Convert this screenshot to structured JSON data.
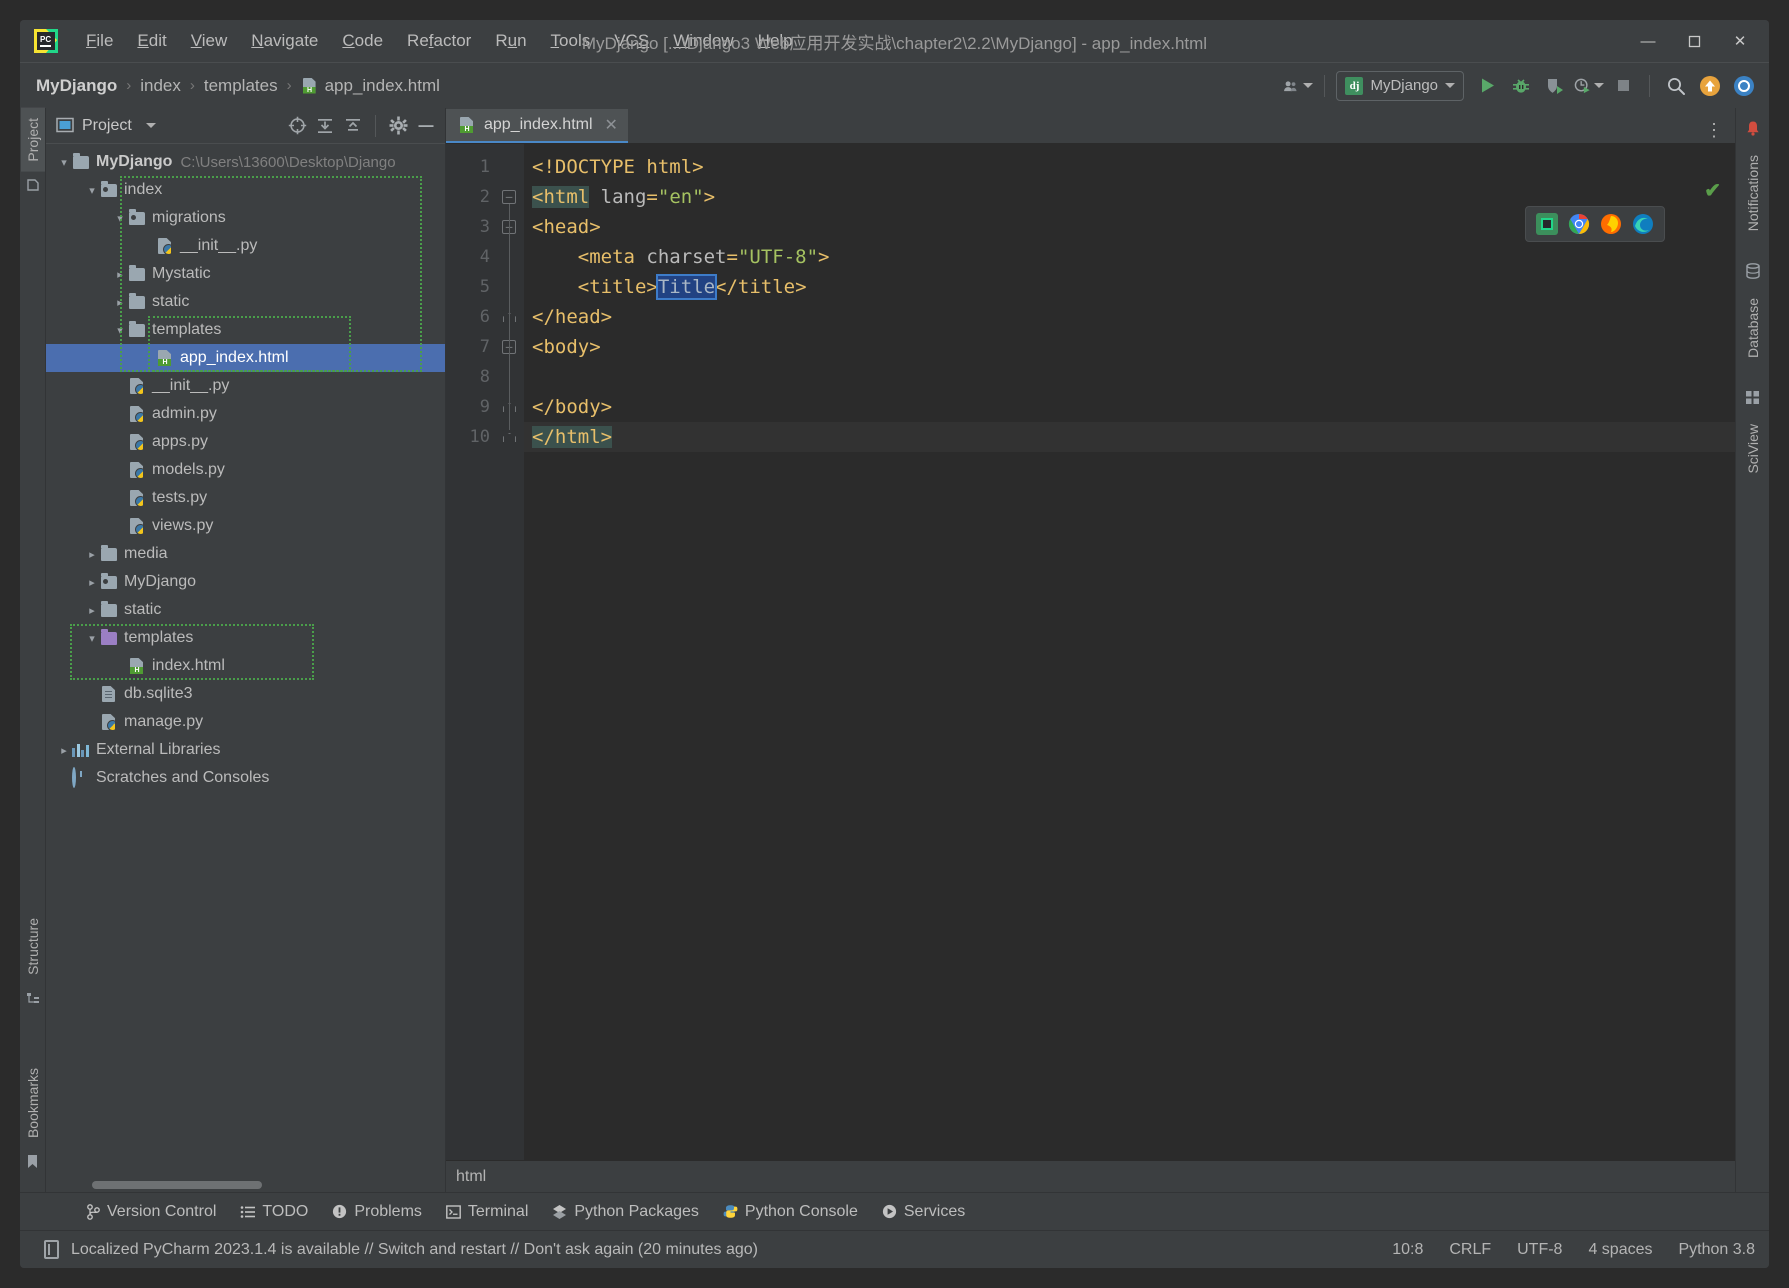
{
  "window": {
    "title": "MyDjango [...\\Django3 Web应用开发实战\\chapter2\\2.2\\MyDjango] - app_index.html",
    "logo_icon": "pycharm-logo-icon",
    "minimize": "—",
    "maximize": "☐",
    "close": "✕"
  },
  "menu": [
    {
      "label": "File"
    },
    {
      "label": "Edit"
    },
    {
      "label": "View"
    },
    {
      "label": "Navigate"
    },
    {
      "label": "Code"
    },
    {
      "label": "Refactor"
    },
    {
      "label": "Run"
    },
    {
      "label": "Tools"
    },
    {
      "label": "VCS"
    },
    {
      "label": "Window"
    },
    {
      "label": "Help"
    }
  ],
  "breadcrumb": {
    "items": [
      "MyDjango",
      "index",
      "templates",
      "app_index.html"
    ],
    "separator": "›",
    "file_icon": "html-file-icon"
  },
  "toolbar": {
    "profile_icon": "user-group-icon",
    "run_config": {
      "badge": "dj",
      "label": "MyDjango",
      "dropdown_icon": "chevron-down-icon"
    },
    "run_icon": "run-play-icon",
    "debug_icon": "debug-bug-icon",
    "coverage_icon": "run-coverage-icon",
    "profile_run_icon": "profiler-clock-icon",
    "stop_icon": "stop-square-icon",
    "search_icon": "search-magnifier-icon",
    "update_icon": "update-arrow-icon",
    "ide_icon": "ide-settings-icon"
  },
  "left_rail": {
    "tabs": [
      "Project",
      "Structure",
      "Bookmarks"
    ],
    "active": "Project",
    "commit_icon": "commit-icon",
    "structure_icon": "structure-icon",
    "bookmark_icon": "bookmark-icon"
  },
  "right_rail": {
    "tabs": [
      "Notifications",
      "Database",
      "SciView"
    ],
    "notification_icon": "bell-icon",
    "database_icon": "database-icon",
    "sciview_icon": "sciview-grid-icon"
  },
  "project_panel": {
    "icon": "project-window-icon",
    "title": "Project",
    "dropdown_icon": "chevron-down-icon",
    "actions": [
      {
        "name": "select-opened-file-icon",
        "glyph": "⊕"
      },
      {
        "name": "expand-all-icon",
        "glyph": "⤓"
      },
      {
        "name": "collapse-all-icon",
        "glyph": "⤒"
      },
      {
        "name": "settings-gear-icon",
        "glyph": "⚙"
      },
      {
        "name": "hide-panel-icon",
        "glyph": "—"
      }
    ],
    "tree": [
      {
        "label": "MyDjango",
        "path": "C:\\Users\\13600\\Desktop\\Django",
        "depth": 0,
        "twisty": "v",
        "icon": "folder",
        "bold": true
      },
      {
        "label": "index",
        "depth": 1,
        "twisty": "v",
        "icon": "folder-module",
        "marked": true
      },
      {
        "label": "migrations",
        "depth": 2,
        "twisty": "v",
        "icon": "folder-module",
        "marked": true
      },
      {
        "label": "__init__.py",
        "depth": 3,
        "twisty": "",
        "icon": "python-file",
        "marked": true
      },
      {
        "label": "Mystatic",
        "depth": 2,
        "twisty": ">",
        "icon": "folder",
        "marked": true
      },
      {
        "label": "static",
        "depth": 2,
        "twisty": ">",
        "icon": "folder",
        "marked": true
      },
      {
        "label": "templates",
        "depth": 2,
        "twisty": "v",
        "icon": "folder",
        "marked": true
      },
      {
        "label": "app_index.html",
        "depth": 3,
        "twisty": "",
        "icon": "html-file",
        "selected": true,
        "marked": true
      },
      {
        "label": "__init__.py",
        "depth": 2,
        "twisty": "",
        "icon": "python-file"
      },
      {
        "label": "admin.py",
        "depth": 2,
        "twisty": "",
        "icon": "python-file"
      },
      {
        "label": "apps.py",
        "depth": 2,
        "twisty": "",
        "icon": "python-file"
      },
      {
        "label": "models.py",
        "depth": 2,
        "twisty": "",
        "icon": "python-file"
      },
      {
        "label": "tests.py",
        "depth": 2,
        "twisty": "",
        "icon": "python-file"
      },
      {
        "label": "views.py",
        "depth": 2,
        "twisty": "",
        "icon": "python-file"
      },
      {
        "label": "media",
        "depth": 1,
        "twisty": ">",
        "icon": "folder"
      },
      {
        "label": "MyDjango",
        "depth": 1,
        "twisty": ">",
        "icon": "folder-module"
      },
      {
        "label": "static",
        "depth": 1,
        "twisty": ">",
        "icon": "folder"
      },
      {
        "label": "templates",
        "depth": 1,
        "twisty": "v",
        "icon": "folder-purple",
        "marked": true
      },
      {
        "label": "index.html",
        "depth": 2,
        "twisty": "",
        "icon": "html-file",
        "marked": true
      },
      {
        "label": "db.sqlite3",
        "depth": 1,
        "twisty": "",
        "icon": "db-file"
      },
      {
        "label": "manage.py",
        "depth": 1,
        "twisty": "",
        "icon": "python-file"
      },
      {
        "label": "External Libraries",
        "depth": 0,
        "twisty": ">",
        "icon": "library"
      },
      {
        "label": "Scratches and Consoles",
        "depth": 0,
        "twisty": "",
        "icon": "scratches"
      }
    ]
  },
  "editor": {
    "tab": {
      "label": "app_index.html",
      "icon": "html-file-icon",
      "close_icon": "close-icon"
    },
    "kebab_icon": "more-options-icon",
    "inspection_ok_icon": "inspection-passed-check",
    "preview_browsers": [
      "pycharm-preview-icon",
      "chrome-icon",
      "firefox-icon",
      "edge-icon"
    ],
    "breadcrumb_text": "html",
    "lines": [
      {
        "n": 1,
        "fold": "",
        "tokens": [
          {
            "t": "tag",
            "s": "<!DOCTYPE html>"
          }
        ]
      },
      {
        "n": 2,
        "fold": "open",
        "tokens": [
          {
            "t": "tag",
            "s": "<html",
            "cls": "match"
          },
          {
            "t": "plain",
            "s": " "
          },
          {
            "t": "attr",
            "s": "lang"
          },
          {
            "t": "tag",
            "s": "="
          },
          {
            "t": "val",
            "s": "\"en\""
          },
          {
            "t": "tag",
            "s": ">"
          }
        ]
      },
      {
        "n": 3,
        "fold": "open",
        "tokens": [
          {
            "t": "tag",
            "s": "<head>"
          }
        ]
      },
      {
        "n": 4,
        "fold": "",
        "tokens": [
          {
            "t": "plain",
            "s": "    "
          },
          {
            "t": "tag",
            "s": "<meta "
          },
          {
            "t": "attr",
            "s": "charset"
          },
          {
            "t": "tag",
            "s": "="
          },
          {
            "t": "val",
            "s": "\"UTF-8\""
          },
          {
            "t": "tag",
            "s": ">"
          }
        ]
      },
      {
        "n": 5,
        "fold": "",
        "tokens": [
          {
            "t": "plain",
            "s": "    "
          },
          {
            "t": "tag",
            "s": "<title>"
          },
          {
            "t": "sel",
            "s": "Title"
          },
          {
            "t": "tag",
            "s": "</title>"
          }
        ]
      },
      {
        "n": 6,
        "fold": "close",
        "tokens": [
          {
            "t": "tag",
            "s": "</head>"
          }
        ]
      },
      {
        "n": 7,
        "fold": "open",
        "tokens": [
          {
            "t": "tag",
            "s": "<body>"
          }
        ]
      },
      {
        "n": 8,
        "fold": "",
        "tokens": []
      },
      {
        "n": 9,
        "fold": "close",
        "tokens": [
          {
            "t": "tag",
            "s": "</body>"
          }
        ]
      },
      {
        "n": 10,
        "fold": "close",
        "current": true,
        "tokens": [
          {
            "t": "tag",
            "s": "</html>",
            "cls": "match"
          }
        ]
      }
    ]
  },
  "bottom_tools": [
    {
      "label": "Version Control",
      "icon": "version-control-branch-icon",
      "glyph": "⑂"
    },
    {
      "label": "TODO",
      "icon": "todo-list-icon",
      "glyph": "≡"
    },
    {
      "label": "Problems",
      "icon": "problems-warning-icon",
      "glyph": "❗"
    },
    {
      "label": "Terminal",
      "icon": "terminal-icon",
      "glyph": "▸_"
    },
    {
      "label": "Python Packages",
      "icon": "python-packages-icon",
      "glyph": "◈"
    },
    {
      "label": "Python Console",
      "icon": "python-console-icon",
      "glyph": "⎇"
    },
    {
      "label": "Services",
      "icon": "services-play-icon",
      "glyph": "▶"
    }
  ],
  "status_bar": {
    "notebook_icon": "notebook-icon",
    "message": "Localized PyCharm 2023.1.4 is available // Switch and restart // Don't ask again (20 minutes ago)",
    "caret": "10:8",
    "line_sep": "CRLF",
    "encoding": "UTF-8",
    "indent": "4 spaces",
    "interpreter": "Python 3.8"
  },
  "colors": {
    "bg": "#3c3f41",
    "editor_bg": "#2b2b2b",
    "selection_blue": "#4b6eaf",
    "tag_orange": "#e8bf6a",
    "string_green": "#a5c261",
    "marked_dir_green": "#4a9e4a",
    "run_green": "#59a869"
  }
}
